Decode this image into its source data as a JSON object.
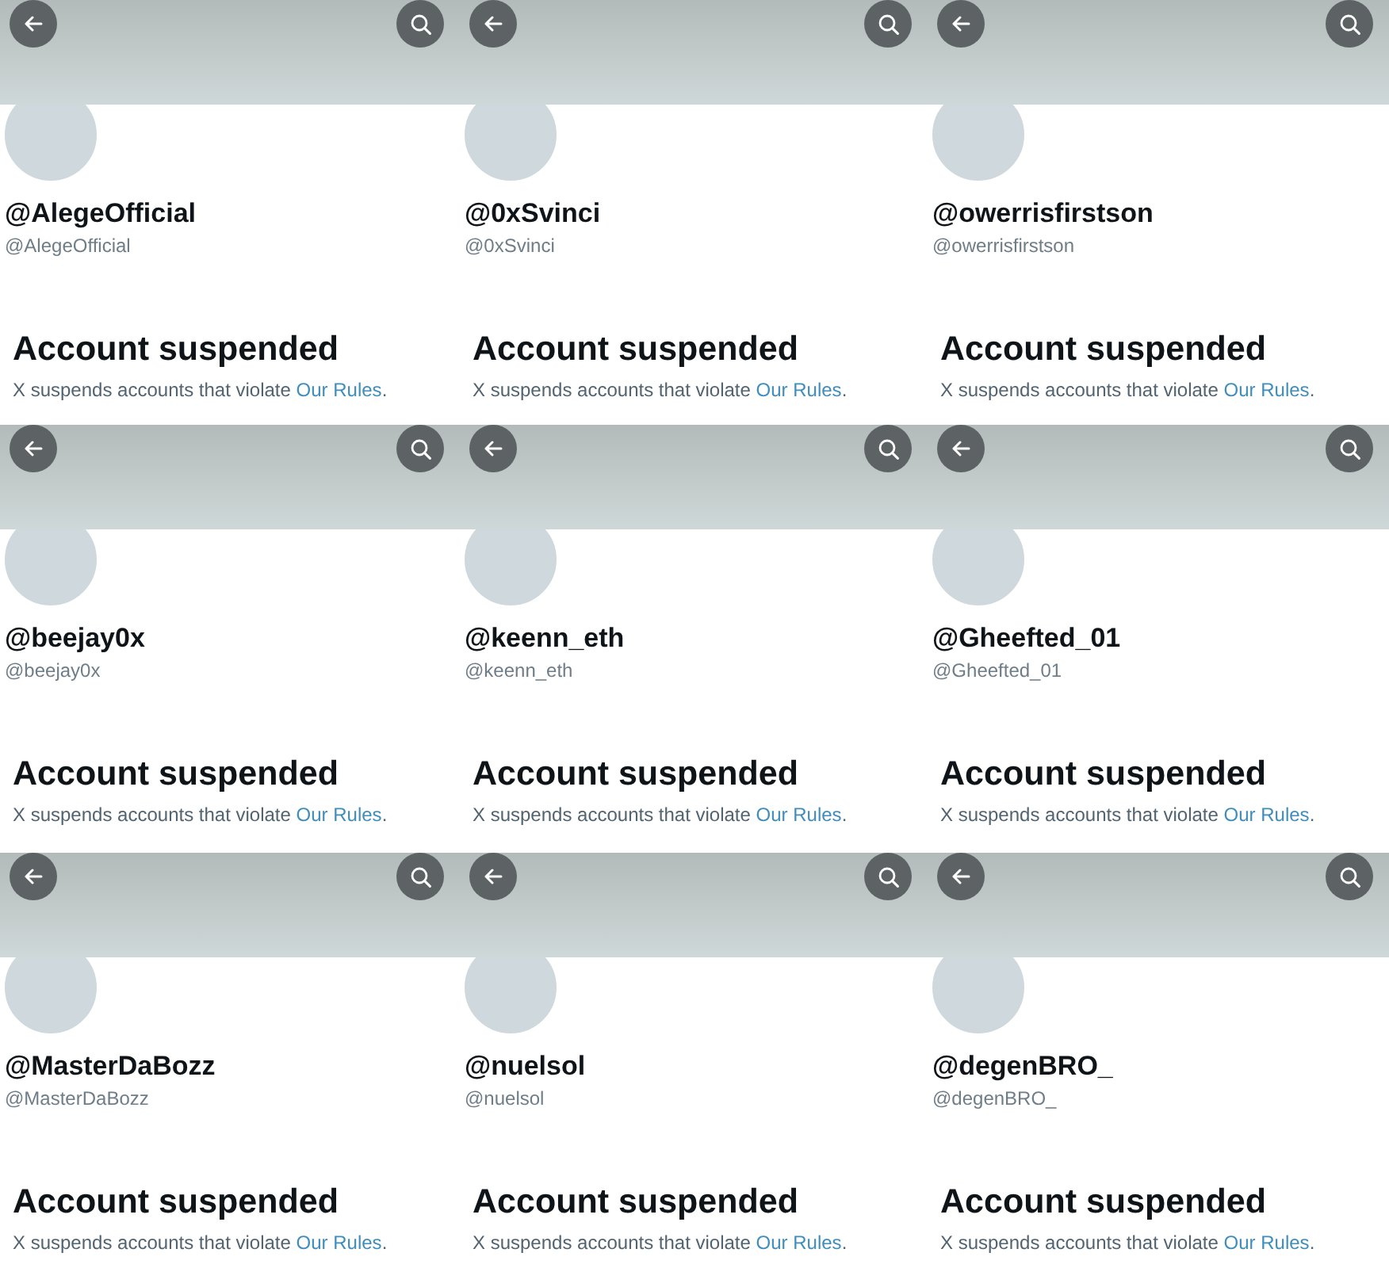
{
  "panels": [
    {
      "display_name": "@AlegeOfficial",
      "handle": "@AlegeOfficial",
      "title": "Account suspended",
      "message": "X suspends accounts that violate",
      "link": "Our Rules",
      "message_end": "."
    },
    {
      "display_name": "@0xSvinci",
      "handle": "@0xSvinci",
      "title": "Account suspended",
      "message": "X suspends accounts that violate",
      "link": "Our Rules",
      "message_end": "."
    },
    {
      "display_name": "@owerrisfirstson",
      "handle": "@owerrisfirstson",
      "title": "Account suspended",
      "message": "X suspends accounts that violate",
      "link": "Our Rules",
      "message_end": "."
    },
    {
      "display_name": "@beejay0x",
      "handle": "@beejay0x",
      "title": "Account suspended",
      "message": "X suspends accounts that violate",
      "link": "Our Rules",
      "message_end": "."
    },
    {
      "display_name": "@keenn_eth",
      "handle": "@keenn_eth",
      "title": "Account suspended",
      "message": "X suspends accounts that violate",
      "link": "Our Rules",
      "message_end": "."
    },
    {
      "display_name": "@Gheefted_01",
      "handle": "@Gheefted_01",
      "title": "Account suspended",
      "message": "X suspends accounts that violate",
      "link": "Our Rules",
      "message_end": "."
    },
    {
      "display_name": "@MasterDaBozz",
      "handle": "@MasterDaBozz",
      "title": "Account suspended",
      "message": "X suspends accounts that violate",
      "link": "Our Rules",
      "message_end": "."
    },
    {
      "display_name": "@nuelsol",
      "handle": "@nuelsol",
      "title": "Account suspended",
      "message": "X suspends accounts that violate",
      "link": "Our Rules",
      "message_end": "."
    },
    {
      "display_name": "@degenBRO_",
      "handle": "@degenBRO_",
      "title": "Account suspended",
      "message": "X suspends accounts that violate",
      "link": "Our Rules",
      "message_end": "."
    }
  ]
}
